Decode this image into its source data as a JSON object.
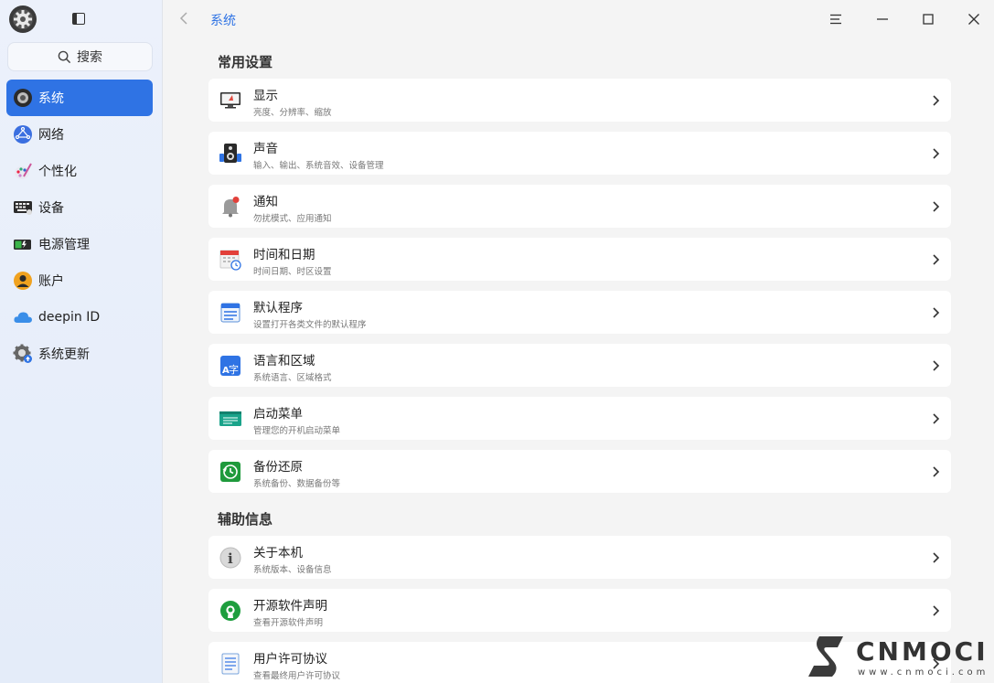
{
  "sidebar": {
    "search_label": "搜索",
    "items": [
      {
        "label": "系统",
        "icon": "system-icon",
        "active": true
      },
      {
        "label": "网络",
        "icon": "network-icon"
      },
      {
        "label": "个性化",
        "icon": "personalization-icon"
      },
      {
        "label": "设备",
        "icon": "device-icon"
      },
      {
        "label": "电源管理",
        "icon": "power-icon"
      },
      {
        "label": "账户",
        "icon": "account-icon"
      },
      {
        "label": "deepin ID",
        "icon": "cloud-icon"
      },
      {
        "label": "系统更新",
        "icon": "update-icon"
      }
    ]
  },
  "titlebar": {
    "breadcrumb": "系统"
  },
  "sections": [
    {
      "title": "常用设置",
      "items": [
        {
          "title": "显示",
          "subtitle": "亮度、分辨率、缩放",
          "icon": "display-icon"
        },
        {
          "title": "声音",
          "subtitle": "输入、输出、系统音效、设备管理",
          "icon": "sound-icon"
        },
        {
          "title": "通知",
          "subtitle": "勿扰模式、应用通知",
          "icon": "notification-icon"
        },
        {
          "title": "时间和日期",
          "subtitle": "时间日期、时区设置",
          "icon": "calendar-icon"
        },
        {
          "title": "默认程序",
          "subtitle": "设置打开各类文件的默认程序",
          "icon": "default-apps-icon"
        },
        {
          "title": "语言和区域",
          "subtitle": "系统语言、区域格式",
          "icon": "language-icon"
        },
        {
          "title": "启动菜单",
          "subtitle": "管理您的开机启动菜单",
          "icon": "boot-menu-icon"
        },
        {
          "title": "备份还原",
          "subtitle": "系统备份、数据备份等",
          "icon": "backup-icon"
        }
      ]
    },
    {
      "title": "辅助信息",
      "items": [
        {
          "title": "关于本机",
          "subtitle": "系统版本、设备信息",
          "icon": "info-icon"
        },
        {
          "title": "开源软件声明",
          "subtitle": "查看开源软件声明",
          "icon": "opensource-icon"
        },
        {
          "title": "用户许可协议",
          "subtitle": "查看最终用户许可协议",
          "icon": "license-icon"
        }
      ]
    }
  ],
  "watermark": {
    "text": "CNMOCI",
    "url": "www.cnmoci.com"
  },
  "colors": {
    "accent": "#2f73e4",
    "sidebar_bg": "#e8eef9",
    "content_bg": "#f4f4f4"
  }
}
